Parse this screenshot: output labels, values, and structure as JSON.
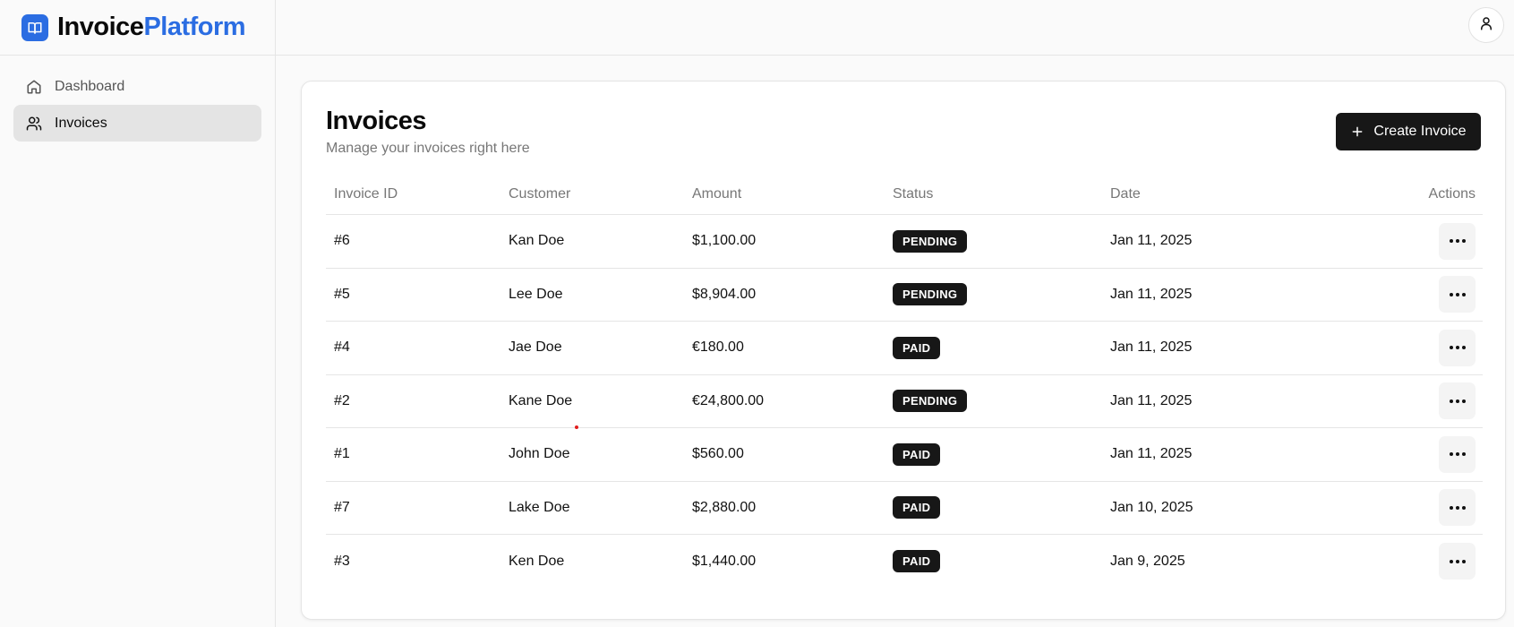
{
  "brand": {
    "part1": "Invoice",
    "part2": "Platform",
    "accent": "#2b6de2"
  },
  "sidebar": {
    "items": [
      {
        "label": "Dashboard",
        "icon": "home-icon",
        "active": false
      },
      {
        "label": "Invoices",
        "icon": "users-icon",
        "active": true
      }
    ]
  },
  "topbar": {
    "avatar_icon": "user-icon"
  },
  "main": {
    "title": "Invoices",
    "subtitle": "Manage your invoices right here",
    "create_button": {
      "label": "Create Invoice",
      "icon": "plus-icon"
    },
    "table": {
      "headers": [
        "Invoice ID",
        "Customer",
        "Amount",
        "Status",
        "Date",
        "Actions"
      ],
      "rows": [
        {
          "id": "#6",
          "customer": "Kan Doe",
          "amount": "$1,100.00",
          "status": "PENDING",
          "date": "Jan 11, 2025"
        },
        {
          "id": "#5",
          "customer": "Lee Doe",
          "amount": "$8,904.00",
          "status": "PENDING",
          "date": "Jan 11, 2025"
        },
        {
          "id": "#4",
          "customer": "Jae Doe",
          "amount": "€180.00",
          "status": "PAID",
          "date": "Jan 11, 2025"
        },
        {
          "id": "#2",
          "customer": "Kane Doe",
          "amount": "€24,800.00",
          "status": "PENDING",
          "date": "Jan 11, 2025"
        },
        {
          "id": "#1",
          "customer": "John Doe",
          "amount": "$560.00",
          "status": "PAID",
          "date": "Jan 11, 2025"
        },
        {
          "id": "#7",
          "customer": "Lake Doe",
          "amount": "$2,880.00",
          "status": "PAID",
          "date": "Jan 10, 2025"
        },
        {
          "id": "#3",
          "customer": "Ken Doe",
          "amount": "$1,440.00",
          "status": "PAID",
          "date": "Jan 9, 2025"
        }
      ]
    }
  },
  "colors": {
    "primary_dark": "#171717",
    "border": "#e5e5e5",
    "muted_text": "#777777"
  }
}
